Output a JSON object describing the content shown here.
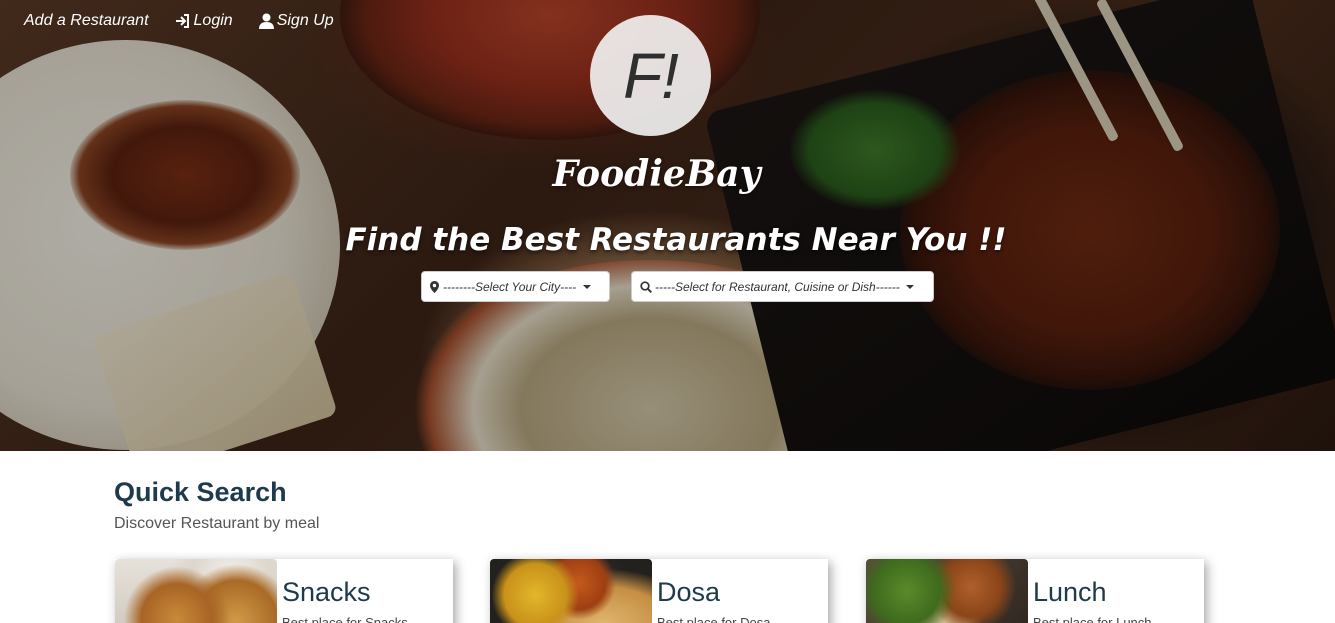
{
  "nav": {
    "add_restaurant": "Add a Restaurant",
    "login": "Login",
    "signup": "Sign Up"
  },
  "hero": {
    "logo_text": "F!",
    "brand": "FoodieBay",
    "tagline": "Find the Best Restaurants Near You !!"
  },
  "search": {
    "city_label": "--------Select Your City----",
    "restaurant_label": "-----Select for Restaurant, Cuisine or Dish------"
  },
  "quick_search": {
    "title": "Quick Search",
    "subtitle": "Discover Restaurant by meal",
    "cards": [
      {
        "name": "Snacks",
        "desc": "Best place for Snacks"
      },
      {
        "name": "Dosa",
        "desc": "Best place for Dosa"
      },
      {
        "name": "Lunch",
        "desc": "Best place for Lunch"
      }
    ]
  },
  "icons": {
    "login": "login-icon",
    "signup": "user-icon",
    "city": "map-marker-icon",
    "search": "search-icon",
    "dropdown": "caret-down-icon"
  },
  "colors": {
    "heading": "#1e3b4b",
    "hero_text": "#ffffff"
  }
}
